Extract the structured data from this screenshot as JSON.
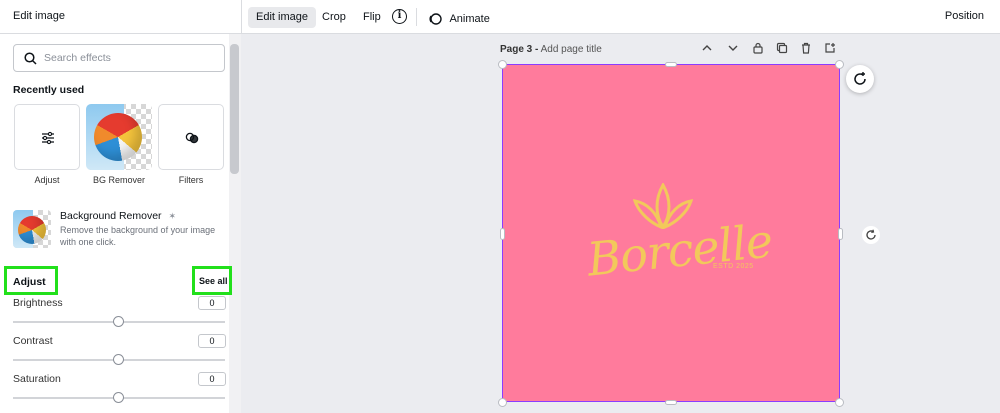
{
  "topbar": {
    "panel_title": "Edit image",
    "edit_image": "Edit image",
    "crop": "Crop",
    "flip": "Flip",
    "info": "i",
    "animate": "Animate",
    "position": "Position"
  },
  "sidebar": {
    "search_placeholder": "Search effects",
    "recently_used_title": "Recently used",
    "recent": [
      {
        "label": "Adjust",
        "icon": "sliders-icon"
      },
      {
        "label": "BG Remover",
        "icon": "beach-ball-image"
      },
      {
        "label": "Filters",
        "icon": "filters-icon"
      }
    ],
    "bg_remover": {
      "title": "Background Remover",
      "badge": "✶",
      "description": "Remove the background of your image with one click."
    },
    "adjust": {
      "title": "Adjust",
      "see_all": "See all",
      "sliders": [
        {
          "label": "Brightness",
          "value": "0",
          "level": 0.5
        },
        {
          "label": "Contrast",
          "value": "0",
          "level": 0.5
        },
        {
          "label": "Saturation",
          "value": "0",
          "level": 0.5
        }
      ]
    },
    "highlight_color": "#22e01b"
  },
  "canvas": {
    "page_label": "Page 3 -",
    "page_title_placeholder": "Add page title",
    "background_color": "#ff7b9c",
    "logo_text": "Borcelle",
    "logo_subtext": "ESTD 2025",
    "logo_color": "#f2c85b"
  }
}
